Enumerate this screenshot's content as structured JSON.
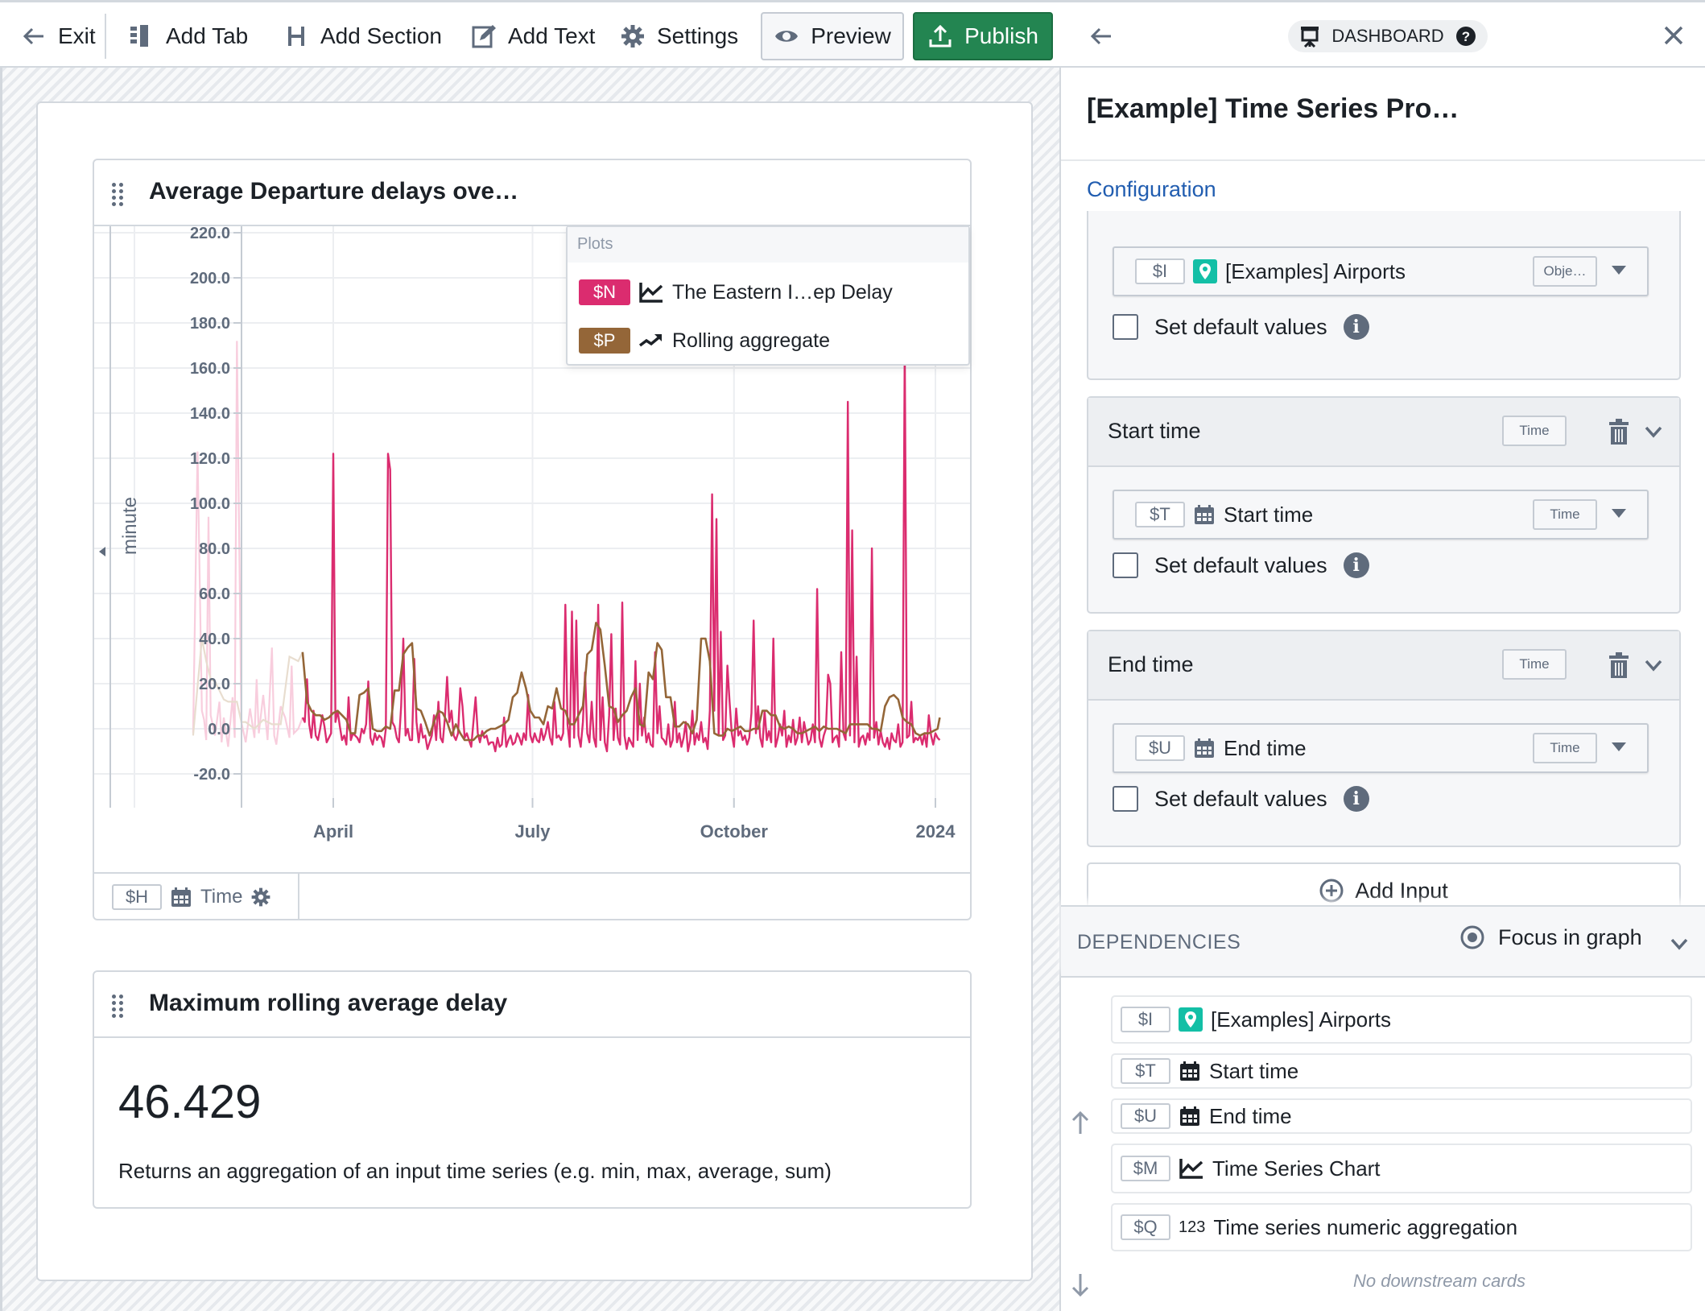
{
  "toolbar": {
    "exit": "Exit",
    "add_tab": "Add Tab",
    "add_section": "Add Section",
    "add_text": "Add Text",
    "settings": "Settings",
    "preview": "Preview",
    "publish": "Publish"
  },
  "colors": {
    "series_primary": "#db2c6f",
    "series_rolling": "#946638",
    "publish": "#238551",
    "accent": "#215db0",
    "object_icon": "#13bfa6"
  },
  "chart_card": {
    "title": "Average Departure delays ove…",
    "legend": {
      "header": "Plots",
      "items": [
        {
          "tag": "$N",
          "label": "The Eastern I…ep Delay",
          "icon": "line-chart-icon"
        },
        {
          "tag": "$P",
          "label": "Rolling aggregate",
          "icon": "trend-up-icon"
        }
      ]
    },
    "x_control": {
      "tag": "$H",
      "label": "Time"
    }
  },
  "chart_data": {
    "type": "line",
    "title": "Average Departure delays ove…",
    "xlabel": "Time",
    "ylabel": "minute",
    "ylim": [
      -20,
      220
    ],
    "yticks": [
      "220.0",
      "200.0",
      "180.0",
      "160.0",
      "140.0",
      "120.0",
      "100.0",
      "80.0",
      "60.0",
      "40.0",
      "20.0",
      "0.0",
      "-20.0"
    ],
    "xticks": [
      {
        "label": "April",
        "day": 0
      },
      {
        "label": "July",
        "day": 91
      },
      {
        "label": "October",
        "day": 183
      },
      {
        "label": "2024",
        "day": 275
      }
    ],
    "xlim_days": [
      -42,
      290
    ],
    "grid": true,
    "legend_position": "top-right",
    "faded_before_day": -14,
    "series": [
      {
        "name": "The Eastern I…ep Delay",
        "tag": "$N",
        "x_days": [
          -64,
          -62,
          -60,
          -59,
          -58,
          -57,
          -56,
          -54,
          -52,
          -51,
          -50,
          -48,
          -46,
          -45,
          -44,
          -42,
          -40,
          -38,
          -36,
          -35,
          -34,
          -32,
          -30,
          -28,
          -27,
          -26,
          -24,
          -22,
          -20,
          -19,
          -18,
          -16,
          -14,
          -13,
          -12,
          -11,
          -10,
          -9,
          -8,
          -7,
          -6,
          -5,
          -4,
          -3,
          -2,
          -1,
          0,
          1,
          2,
          3,
          4,
          5,
          6,
          7,
          8,
          9,
          10,
          11,
          12,
          13,
          14,
          15,
          16,
          17,
          18,
          19,
          20,
          21,
          22,
          23,
          24,
          25,
          26,
          27,
          28,
          29,
          30,
          31,
          32,
          33,
          34,
          35,
          36,
          37,
          38,
          39,
          40,
          41,
          42,
          43,
          44,
          45,
          46,
          47,
          48,
          49,
          50,
          51,
          52,
          53,
          54,
          55,
          56,
          57,
          58,
          59,
          60,
          61,
          62,
          63,
          64,
          65,
          66,
          67,
          68,
          69,
          70,
          71,
          72,
          73,
          74,
          75,
          76,
          77,
          78,
          79,
          80,
          81,
          82,
          83,
          84,
          85,
          86,
          87,
          88,
          89,
          90,
          91,
          92,
          93,
          94,
          95,
          96,
          97,
          98,
          99,
          100,
          101,
          102,
          103,
          104,
          105,
          106,
          107,
          108,
          109,
          110,
          111,
          112,
          113,
          114,
          115,
          116,
          117,
          118,
          119,
          120,
          121,
          122,
          123,
          124,
          125,
          126,
          127,
          128,
          129,
          130,
          131,
          132,
          133,
          134,
          135,
          136,
          137,
          138,
          139,
          140,
          141,
          142,
          143,
          144,
          145,
          146,
          147,
          148,
          149,
          150,
          151,
          152,
          153,
          154,
          155,
          156,
          157,
          158,
          159,
          160,
          161,
          162,
          163,
          164,
          165,
          166,
          167,
          168,
          169,
          170,
          171,
          172,
          173,
          174,
          175,
          176,
          177,
          178,
          179,
          180,
          181,
          182,
          183,
          184,
          185,
          186,
          187,
          188,
          189,
          190,
          191,
          192,
          193,
          194,
          195,
          196,
          197,
          198,
          199,
          200,
          201,
          202,
          203,
          204,
          205,
          206,
          207,
          208,
          209,
          210,
          211,
          212,
          213,
          214,
          215,
          216,
          217,
          218,
          219,
          220,
          221,
          222,
          223,
          224,
          225,
          226,
          227,
          228,
          229,
          230,
          231,
          232,
          233,
          234,
          235,
          236,
          237,
          238,
          239,
          240,
          241,
          242,
          243,
          244,
          245,
          246,
          247,
          248,
          249,
          250,
          251,
          252,
          253,
          254,
          255,
          256,
          257,
          258,
          259,
          260,
          261,
          262,
          263,
          264,
          265,
          266,
          267,
          268,
          269,
          270,
          271,
          272,
          273,
          274,
          275,
          276,
          277
        ],
        "values": [
          -2,
          123,
          8,
          4,
          -5,
          94,
          6,
          -3,
          12,
          -6,
          5,
          -8,
          14,
          -4,
          172,
          3,
          -6,
          9,
          -4,
          22,
          -2,
          15,
          -5,
          36,
          -3,
          -7,
          10,
          5,
          -4,
          28,
          -2,
          0,
          5,
          3,
          22,
          2,
          -4,
          8,
          -3,
          -5,
          0,
          6,
          1,
          -6,
          -4,
          -2,
          122,
          3,
          8,
          1,
          -5,
          -3,
          -7,
          14,
          -5,
          -2,
          -3,
          -4,
          -6,
          0,
          -2,
          2,
          21,
          -4,
          -7,
          -2,
          -5,
          -3,
          -4,
          -8,
          0,
          122,
          115,
          3,
          1,
          -4,
          -6,
          10,
          40,
          -3,
          0,
          -5,
          -5,
          31,
          3,
          -6,
          2,
          -4,
          -3,
          -9,
          -6,
          -3,
          6,
          -5,
          12,
          -4,
          -6,
          5,
          23,
          3,
          8,
          -3,
          -5,
          -2,
          18,
          10,
          -4,
          -2,
          -5,
          -8,
          3,
          14,
          -2,
          -6,
          -1,
          -4,
          -3,
          -7,
          -6,
          -6,
          -10,
          -4,
          -8,
          -7,
          5,
          -8,
          -5,
          -3,
          -7,
          -6,
          -2,
          -4,
          -7,
          -2,
          -5,
          15,
          -3,
          -6,
          -2,
          -5,
          -6,
          0,
          -5,
          -2,
          3,
          -4,
          -7,
          12,
          -4,
          -3,
          -5,
          -2,
          55,
          2,
          -8,
          52,
          -4,
          48,
          -3,
          -8,
          3,
          25,
          -2,
          -6,
          12,
          -4,
          -8,
          55,
          -5,
          14,
          -6,
          -10,
          6,
          42,
          -5,
          9,
          -4,
          -7,
          56,
          -3,
          -9,
          -4,
          -6,
          -8,
          30,
          -5,
          20,
          -3,
          5,
          -6,
          -2,
          -7,
          -8,
          34,
          -2,
          10,
          -4,
          -5,
          -7,
          2,
          -8,
          -5,
          12,
          -6,
          -2,
          -8,
          -4,
          3,
          -10,
          -5,
          8,
          -7,
          -2,
          -5,
          3,
          -6,
          -4,
          -9,
          8,
          104,
          8,
          93,
          -3,
          43,
          -5,
          -3,
          28,
          12,
          -2,
          -8,
          9,
          -3,
          -1,
          -5,
          -3,
          -7,
          -4,
          7,
          48,
          -2,
          10,
          -4,
          -8,
          8,
          -5,
          -1,
          -6,
          40,
          -8,
          -4,
          2,
          -3,
          8,
          -8,
          -3,
          -6,
          4,
          -7,
          -4,
          5,
          -6,
          3,
          -2,
          -7,
          -5,
          2,
          -6,
          62,
          -4,
          -8,
          -3,
          0,
          24,
          20,
          -6,
          -4,
          -3,
          -8,
          34,
          -2,
          -5,
          145,
          -3,
          88,
          -6,
          32,
          -8,
          -4,
          -3,
          -7,
          -2,
          -5,
          80,
          -4,
          3,
          -7,
          -1,
          -6,
          -8,
          -4,
          -9,
          -2,
          -5,
          -6,
          2,
          -8,
          -6,
          170,
          -4,
          -3,
          12,
          -6,
          -4,
          -5,
          -3,
          -7,
          -2,
          -8,
          6,
          -3,
          -7,
          -2,
          -4,
          -5
        ],
        "color": "#db2c6f"
      },
      {
        "name": "Rolling aggregate",
        "tag": "$P",
        "x_days": [
          -64,
          -60,
          -58,
          -56,
          -54,
          -50,
          -48,
          -46,
          -44,
          -42,
          -40,
          -36,
          -32,
          -28,
          -24,
          -20,
          -16,
          -14,
          -12,
          -10,
          -8,
          -6,
          -4,
          -2,
          0,
          2,
          4,
          6,
          8,
          10,
          12,
          14,
          16,
          18,
          20,
          22,
          24,
          26,
          28,
          30,
          32,
          34,
          36,
          38,
          40,
          42,
          44,
          46,
          48,
          50,
          52,
          54,
          56,
          58,
          60,
          62,
          64,
          66,
          68,
          70,
          72,
          74,
          76,
          78,
          80,
          82,
          84,
          86,
          88,
          90,
          92,
          94,
          96,
          98,
          100,
          102,
          104,
          106,
          108,
          110,
          112,
          114,
          116,
          118,
          120,
          122,
          124,
          126,
          128,
          130,
          132,
          134,
          136,
          138,
          140,
          142,
          144,
          146,
          148,
          150,
          152,
          154,
          156,
          158,
          160,
          162,
          164,
          166,
          168,
          170,
          172,
          174,
          176,
          178,
          180,
          182,
          184,
          186,
          188,
          190,
          192,
          194,
          196,
          198,
          200,
          202,
          204,
          206,
          208,
          210,
          212,
          214,
          216,
          218,
          220,
          222,
          224,
          226,
          228,
          230,
          232,
          234,
          236,
          238,
          240,
          242,
          244,
          246,
          248,
          250,
          252,
          254,
          256,
          258,
          260,
          262,
          264,
          266,
          268,
          270,
          272,
          274,
          276,
          277
        ],
        "values": [
          -3,
          40,
          30,
          22,
          21,
          13,
          12,
          12,
          12,
          3,
          3,
          0,
          4,
          2,
          2,
          32,
          30,
          34,
          12,
          8,
          6,
          6,
          4,
          5,
          7,
          8,
          6,
          4,
          -2,
          -2,
          15,
          16,
          18,
          0,
          -1,
          -1,
          1,
          0,
          17,
          17,
          33,
          36,
          38,
          9,
          8,
          3,
          -3,
          3,
          8,
          7,
          3,
          -3,
          2,
          -2,
          -5,
          -5,
          -5,
          -3,
          -3,
          -1,
          0,
          0,
          1,
          2,
          4,
          14,
          16,
          25,
          18,
          8,
          5,
          5,
          2,
          10,
          9,
          18,
          9,
          8,
          2,
          2,
          6,
          10,
          33,
          35,
          47,
          44,
          28,
          10,
          9,
          3,
          6,
          8,
          14,
          18,
          2,
          1,
          25,
          22,
          38,
          35,
          14,
          14,
          1,
          1,
          3,
          2,
          -2,
          4,
          40,
          40,
          30,
          -2,
          -3,
          -3,
          0,
          -1,
          0,
          1,
          -1,
          -1,
          0,
          0,
          8,
          8,
          6,
          6,
          1,
          0,
          1,
          0,
          -2,
          -2,
          -1,
          0,
          1,
          -1,
          1,
          0,
          0,
          0,
          -1,
          -2,
          2,
          2,
          2,
          2,
          2,
          0,
          0,
          -1,
          10,
          14,
          15,
          13,
          5,
          3,
          2,
          -2,
          -3,
          -2,
          -2,
          -1,
          0,
          5,
          4,
          0,
          -1,
          -2,
          -3,
          2,
          2,
          2,
          35,
          37,
          38,
          38,
          38,
          16,
          16
        ],
        "color": "#946638"
      }
    ]
  },
  "metric_card": {
    "title": "Maximum rolling average delay",
    "value": "46.429",
    "description": "Returns an aggregation of an input time series (e.g. min, max, average, sum)"
  },
  "panel": {
    "badge": "DASHBOARD",
    "title": "[Example] Time Series Pro…",
    "tab": "Configuration",
    "sections": [
      {
        "title": null,
        "input": {
          "tag": "$I",
          "icon": "map-pin-icon",
          "label": "[Examples] Airports",
          "type": "Obje…"
        },
        "default_label": "Set default values",
        "default_checked": false
      },
      {
        "title": "Start time",
        "type": "Time",
        "input": {
          "tag": "$T",
          "icon": "calendar-icon",
          "label": "Start time",
          "type": "Time"
        },
        "default_label": "Set default values",
        "default_checked": false
      },
      {
        "title": "End time",
        "type": "Time",
        "input": {
          "tag": "$U",
          "icon": "calendar-icon",
          "label": "End time",
          "type": "Time"
        },
        "default_label": "Set default values",
        "default_checked": false
      }
    ],
    "add_input": "Add Input",
    "dependencies": {
      "title": "DEPENDENCIES",
      "focus": "Focus in graph",
      "items": [
        {
          "tag": "$I",
          "icon": "map-pin-icon",
          "label": "[Examples] Airports"
        },
        {
          "tag": "$T",
          "icon": "calendar-icon",
          "label": "Start time"
        },
        {
          "tag": "$U",
          "icon": "calendar-icon",
          "label": "End time"
        },
        {
          "tag": "$M",
          "icon": "line-chart-icon",
          "label": "Time Series Chart"
        },
        {
          "tag": "$Q",
          "icon": "number-icon",
          "icon_text": "123",
          "label": "Time series numeric aggregation"
        }
      ],
      "empty_downstream": "No downstream cards"
    }
  }
}
